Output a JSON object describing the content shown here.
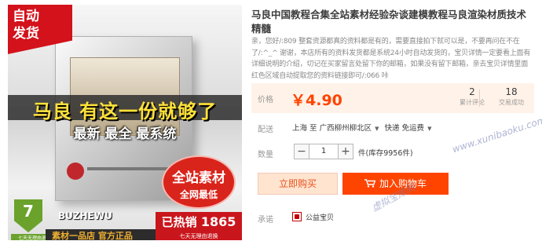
{
  "product_image": {
    "ribbon_line1": "自动",
    "ribbon_line2": "发货",
    "headline": "马良 有这一份就够了",
    "subline": "最新 最全 最系统",
    "promo_line1": "全站素材",
    "promo_line2": "全网最低",
    "shield_text": "7",
    "shield_caption": "七天无理由退换",
    "brand": "BUZHEWU",
    "bottom_text": "素材一品店 官方正品",
    "sold_prefix": "已热销",
    "sold_count": "1865件",
    "delivery_strip": "七天无理由退换"
  },
  "title": "马良中国教程合集全站素材经验杂谈建模教程马良渲染材质技术精髓",
  "description": "亲，您好/:809 整套资源都真的资料都是有的，需要直接拍下就可以是，不要再问在不在了/:^_^ 谢谢，本店所有的资料发货都是系统24小时自动发货的，宝贝详情一定要看上面有详细说明的介绍，切记在买家留言处留下你的邮箱，如果没有留下邮箱，亲去宝贝详情里面红色区域自动提取您的资料链接即可/:066 咔",
  "price": {
    "label": "价格",
    "value": "￥4.90",
    "reviews_count": "2",
    "reviews_label": "累计评论",
    "sales_count": "18",
    "sales_label": "交易成功"
  },
  "delivery": {
    "label": "配送",
    "origin": "上海",
    "to": "至",
    "destination": "广西柳州柳北区",
    "shipping": "快递 免运费"
  },
  "quantity": {
    "label": "数量",
    "minus": "−",
    "value": "1",
    "plus": "+",
    "stock": "件(库存9956件)"
  },
  "actions": {
    "buy_now": "立即购买",
    "add_to_cart": "加入购物车"
  },
  "promise": {
    "label": "承诺",
    "item": "公益宝贝"
  },
  "watermark": {
    "site": "虚拟宝库网",
    "url": "www.xunibaoku.com"
  },
  "colors": {
    "price_orange": "#ff4400",
    "buy_now_bg": "#ffe4d0",
    "ribbon_red": "#d3121b"
  }
}
